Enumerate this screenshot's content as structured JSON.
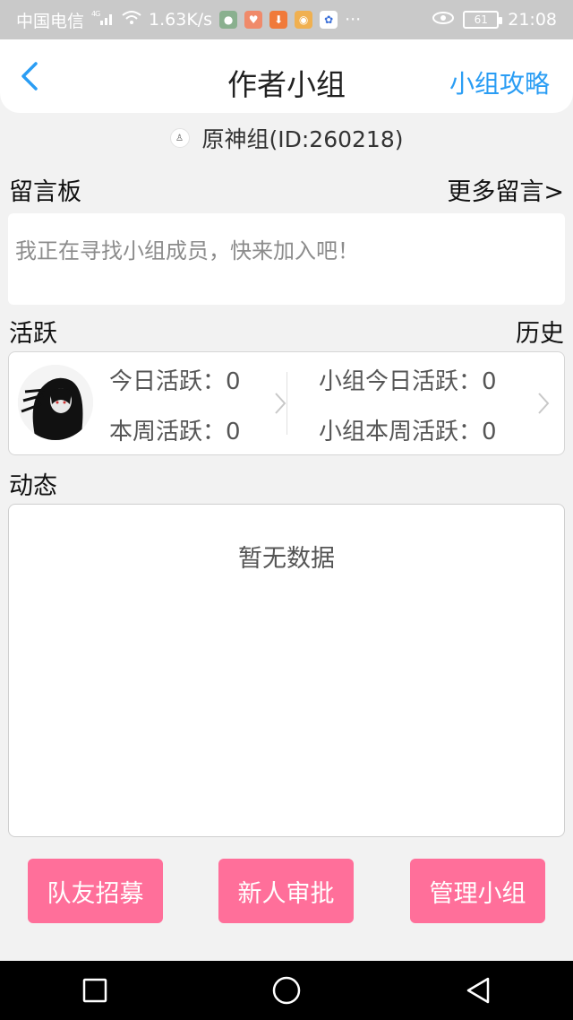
{
  "status_bar": {
    "carrier": "中国电信",
    "net_type": "4G",
    "speed": "1.63K/s",
    "battery": "61",
    "time": "21:08",
    "more": "···"
  },
  "header": {
    "title": "作者小组",
    "action_label": "小组攻略"
  },
  "group": {
    "name_id": "原神组(ID:260218)"
  },
  "message_board": {
    "label": "留言板",
    "more_label": "更多留言>",
    "content": "我正在寻找小组成员，快来加入吧！"
  },
  "activity": {
    "label": "活跃",
    "history_label": "历史",
    "today": "今日活跃：0",
    "week": "本周活跃：0",
    "group_today": "小组今日活跃：0",
    "group_week": "小组本周活跃：0"
  },
  "feed": {
    "label": "动态",
    "empty_text": "暂无数据"
  },
  "buttons": {
    "recruit": "队友招募",
    "approve": "新人审批",
    "manage": "管理小组"
  },
  "colors": {
    "accent_blue": "#2a9df4",
    "button_pink": "#ff6f9a"
  }
}
